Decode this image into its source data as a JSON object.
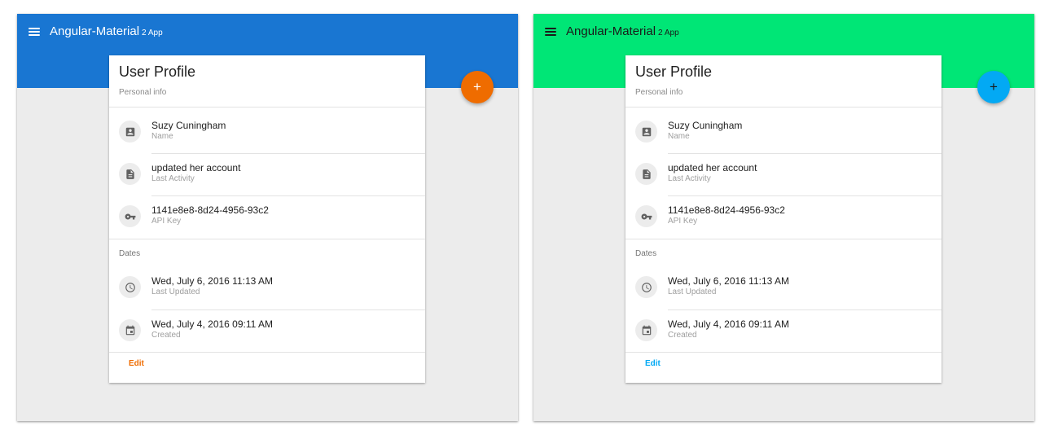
{
  "app": {
    "title": "Angular-Material",
    "title_suffix": "2 App"
  },
  "card": {
    "title": "User Profile",
    "subtitle": "Personal info",
    "items": [
      {
        "primary": "Suzy Cuningham",
        "secondary": "Name",
        "icon": "contact-card-icon"
      },
      {
        "primary": "updated her account",
        "secondary": "Last Activity",
        "icon": "document-icon"
      },
      {
        "primary": "1141e8e8-8d24-4956-93c2",
        "secondary": "API Key",
        "icon": "key-icon"
      }
    ],
    "dates_header": "Dates",
    "dates": [
      {
        "primary": "Wed, July 6, 2016 11:13 AM",
        "secondary": "Last Updated",
        "icon": "clock-icon"
      },
      {
        "primary": "Wed, July 4, 2016 09:11 AM",
        "secondary": "Created",
        "icon": "calendar-icon"
      }
    ],
    "edit_label": "Edit"
  },
  "fab": {
    "label": "+",
    "icon": "plus-icon"
  },
  "themes": {
    "left": {
      "toolbar_bg": "#1976d2",
      "toolbar_fg": "#ffffff",
      "accent": "#ef6c00",
      "fab_fg": "#ffffff"
    },
    "right": {
      "toolbar_bg": "#00e676",
      "toolbar_fg": "#1a1a1a",
      "accent": "#03a9f4",
      "fab_fg": "#1a1a1a"
    }
  },
  "colors": {
    "icon_gray": "#616161",
    "background": "#ececec"
  }
}
